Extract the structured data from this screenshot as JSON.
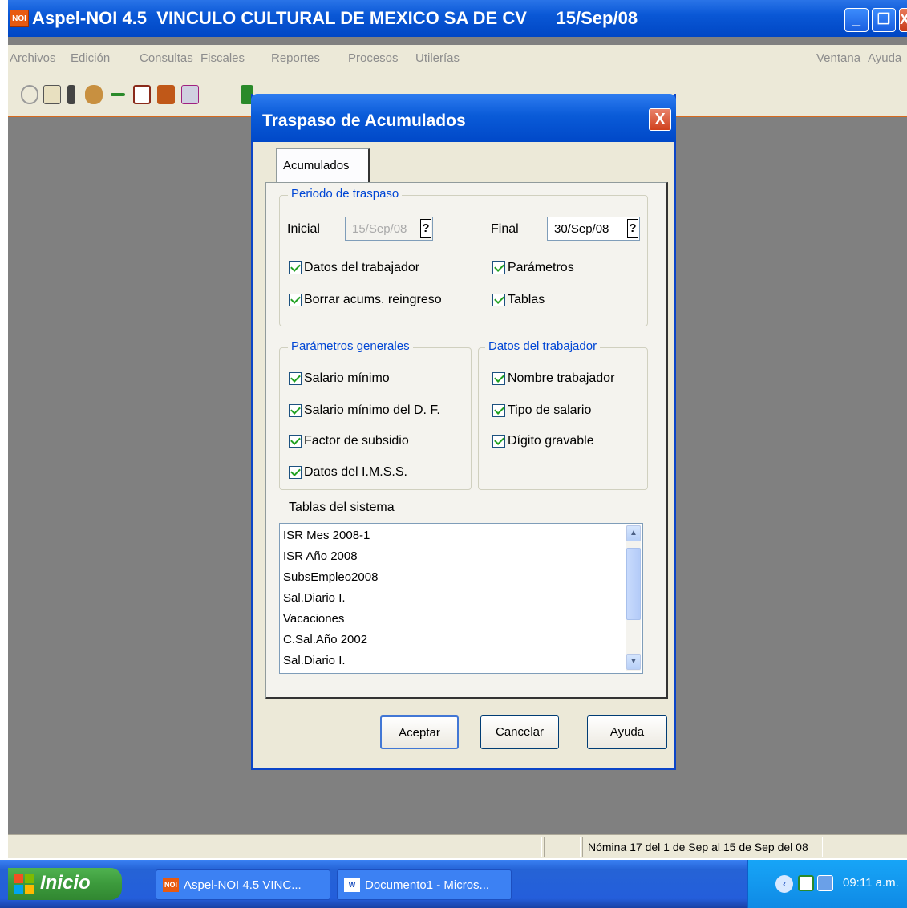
{
  "window": {
    "icon_text": "NOI",
    "title": "Aspel-NOI 4.5  VINCULO CULTURAL DE MEXICO SA DE CV      15/Sep/08",
    "minimize": "_",
    "maximize": "❐",
    "close": "X"
  },
  "menu": {
    "items": [
      "Archivos",
      "Edición",
      "Consultas",
      "Fiscales",
      "Reportes",
      "Procesos",
      "Utilerías"
    ],
    "right_items": [
      "Ventana",
      "Ayuda"
    ]
  },
  "dialog": {
    "title": "Traspaso de Acumulados",
    "close": "X",
    "tab": "Acumulados",
    "periodo": {
      "title": "Periodo de traspaso",
      "inicial_label": "Inicial",
      "inicial_value": "15/Sep/08",
      "final_label": "Final",
      "final_value": "30/Sep/08",
      "help": "?",
      "checks": [
        "Datos del trabajador",
        "Parámetros",
        "Borrar acums. reingreso",
        "Tablas"
      ]
    },
    "parametros": {
      "title": "Parámetros generales",
      "checks": [
        "Salario mínimo",
        "Salario mínimo del D. F.",
        "Factor de subsidio",
        "Datos del I.M.S.S."
      ]
    },
    "datos_trabajador": {
      "title": "Datos del trabajador",
      "checks": [
        "Nombre trabajador",
        "Tipo de salario",
        "Dígito gravable"
      ]
    },
    "tablas": {
      "label": "Tablas del sistema",
      "items": [
        "ISR Mes 2008-1",
        "ISR Año 2008",
        "SubsEmpleo2008",
        "Sal.Diario I.",
        "Vacaciones",
        "C.Sal.Año 2002",
        "Sal.Diario I."
      ]
    },
    "buttons": {
      "accept": "Aceptar",
      "cancel": "Cancelar",
      "help": "Ayuda"
    }
  },
  "status": {
    "nomina": "Nómina 17 del 1 de Sep al 15 de Sep del 08"
  },
  "taskbar": {
    "start": "Inicio",
    "tasks": [
      {
        "icon": "NOI",
        "label": "Aspel-NOI 4.5  VINC..."
      },
      {
        "icon": "W",
        "label": "Documento1 - Micros..."
      }
    ],
    "clock": "09:11 a.m."
  }
}
